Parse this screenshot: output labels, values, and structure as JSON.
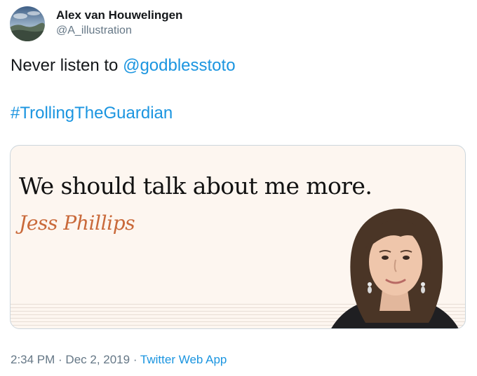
{
  "author": {
    "display_name": "Alex van Houwelingen",
    "handle": "@A_illustration"
  },
  "tweet": {
    "text_before_mention": "Never listen to ",
    "mention": "@godblesstoto",
    "hashtag": "#TrollingTheGuardian"
  },
  "card": {
    "quote": "We should talk about me more.",
    "attribution": "Jess Phillips"
  },
  "meta": {
    "time": "2:34 PM",
    "separator1": " · ",
    "date": "Dec 2, 2019",
    "separator2": " · ",
    "source": "Twitter Web App"
  },
  "colors": {
    "link": "#1b95e0",
    "secondary_text": "#657786",
    "card_background": "#fdf6f0",
    "card_author": "#c9693a"
  },
  "icons": {
    "avatar": "landscape-avatar-image",
    "card_photo": "portrait-photo"
  }
}
